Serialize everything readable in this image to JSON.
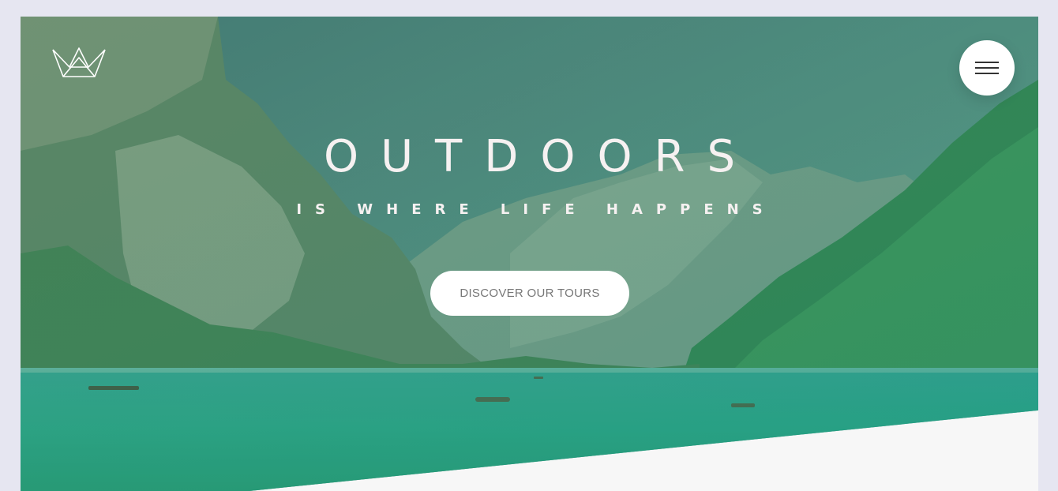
{
  "header": {
    "logo_icon": "crown-logo-icon",
    "menu_icon": "hamburger-menu-icon"
  },
  "hero": {
    "title": "OUTDOORS",
    "subtitle": "IS WHERE LIFE HAPPENS",
    "cta_label": "DISCOVER OUR TOURS"
  },
  "colors": {
    "page_background": "#e6e6f1",
    "section_background": "#f7f7f7",
    "overlay_green": "#28b485",
    "text_light": "#f6f1f1",
    "button_text": "#777777"
  }
}
